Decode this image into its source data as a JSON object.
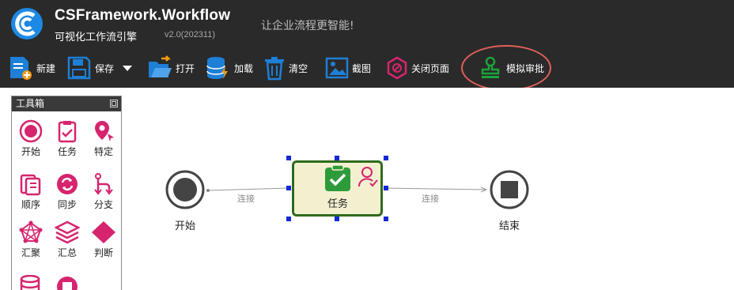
{
  "app": {
    "title": "CSFramework.Workflow",
    "subtitle": "可视化工作流引擎",
    "version": "v2.0(202311)",
    "slogan": "让企业流程更智能!"
  },
  "toolbar": {
    "items": [
      {
        "label": "新建",
        "icon": "new-file-icon"
      },
      {
        "label": "保存",
        "icon": "save-icon"
      },
      {
        "label": "打开",
        "icon": "open-folder-icon"
      },
      {
        "label": "加载",
        "icon": "load-database-icon"
      },
      {
        "label": "清空",
        "icon": "trash-icon"
      },
      {
        "label": "截图",
        "icon": "screenshot-icon"
      },
      {
        "label": "关闭页面",
        "icon": "close-page-icon"
      },
      {
        "label": "模拟审批",
        "icon": "approval-stamp-icon"
      }
    ]
  },
  "toolbox": {
    "title": "工具箱",
    "tools": [
      {
        "label": "开始",
        "icon": "start-icon"
      },
      {
        "label": "任务",
        "icon": "task-icon"
      },
      {
        "label": "特定",
        "icon": "location-pin-icon"
      },
      {
        "label": "顺序",
        "icon": "sequence-icon"
      },
      {
        "label": "同步",
        "icon": "sync-icon"
      },
      {
        "label": "分支",
        "icon": "branch-icon"
      },
      {
        "label": "汇聚",
        "icon": "converge-icon"
      },
      {
        "label": "汇总",
        "icon": "layers-icon"
      },
      {
        "label": "判断",
        "icon": "decision-diamond-icon"
      }
    ]
  },
  "diagram": {
    "start_label": "开始",
    "task_label": "任务",
    "end_label": "结束",
    "edge1_label": "连接",
    "edge2_label": "连接"
  },
  "colors": {
    "header_bg": "#2a2a2a",
    "accent_blue": "#1e7fd6",
    "magenta": "#d6246e",
    "task_border": "#2f6b1e",
    "task_fill": "#f3f0d0",
    "highlight_red": "#e0605a"
  }
}
